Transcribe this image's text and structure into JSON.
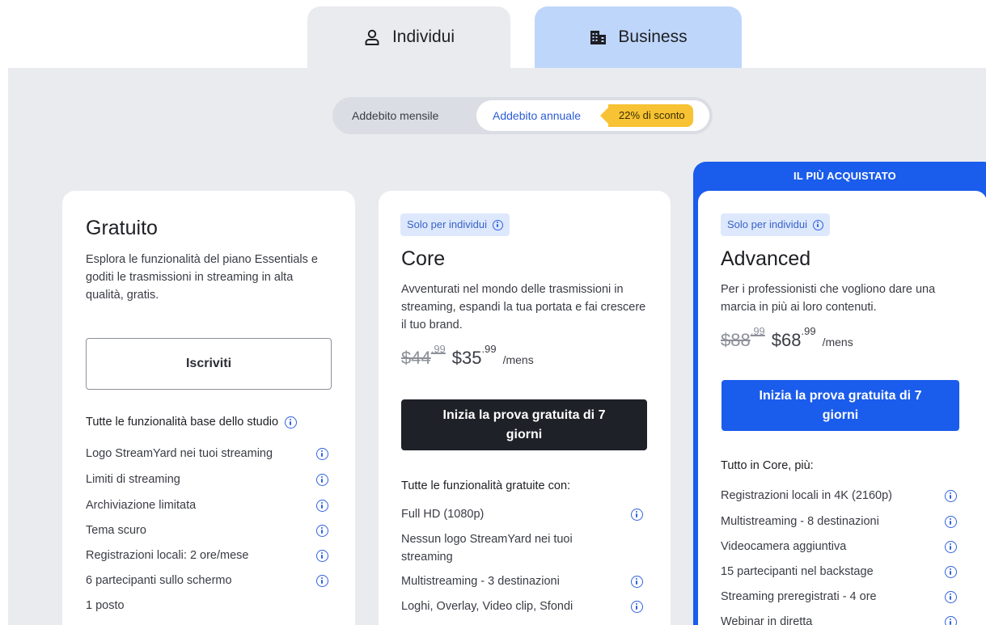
{
  "tabs": [
    {
      "label": "Individui",
      "icon": "person-icon"
    },
    {
      "label": "Business",
      "icon": "building-icon"
    }
  ],
  "billing": {
    "monthly_label": "Addebito mensile",
    "annual_label": "Addebito annuale",
    "discount_badge": "22% di sconto",
    "selected": "annual"
  },
  "colors": {
    "accent": "#1a5cec",
    "badge": "#f7c233",
    "panel_bg": "#e9ebef",
    "business_tab": "#bfd6fb"
  },
  "plans": {
    "free": {
      "title": "Gratuito",
      "description": "Esplora le funzionalità del piano Essentials e goditi le trasmissioni in streaming in alta qualità, gratis.",
      "cta": "Iscriviti",
      "features_heading": "Tutte le funzionalità base dello studio",
      "features": [
        "Logo StreamYard nei tuoi streaming",
        "Limiti di streaming",
        "Archiviazione limitata",
        "Tema scuro",
        "Registrazioni locali: 2 ore/mese",
        "6 partecipanti sullo schermo",
        "1 posto"
      ]
    },
    "core": {
      "tag": "Solo per individui",
      "title": "Core",
      "description": "Avventurati nel mondo delle trasmissioni in streaming, espandi la tua portata e fai crescere il tuo brand.",
      "old_price": "$44",
      "old_cents": ".99",
      "price": "$35",
      "price_cents": ".99",
      "period": "/mens",
      "cta": "Inizia la prova gratuita di 7 giorni",
      "features_heading": "Tutte le funzionalità gratuite con:",
      "features": [
        "Full HD (1080p)",
        "Nessun logo StreamYard nei tuoi streaming",
        "Multistreaming - 3 destinazioni",
        "Loghi, Overlay, Video clip, Sfondi"
      ]
    },
    "advanced": {
      "ribbon": "IL PIÙ ACQUISTATO",
      "tag": "Solo per individui",
      "title": "Advanced",
      "description": "Per i professionisti che vogliono dare una marcia in più ai loro contenuti.",
      "old_price": "$88",
      "old_cents": ".99",
      "price": "$68",
      "price_cents": ".99",
      "period": "/mens",
      "cta": "Inizia la prova gratuita di 7 giorni",
      "features_heading": "Tutto in Core, più:",
      "features": [
        "Registrazioni locali in 4K (2160p)",
        "Multistreaming - 8 destinazioni",
        "Videocamera aggiuntiva",
        "15 partecipanti nel backstage",
        "Streaming preregistrati - 4 ore",
        "Webinar in diretta"
      ]
    }
  }
}
